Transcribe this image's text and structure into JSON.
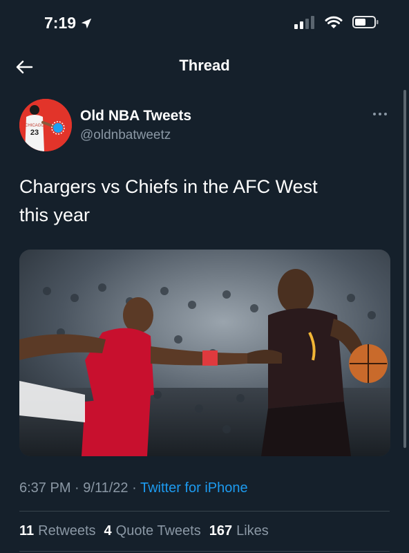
{
  "status_bar": {
    "time": "7:19",
    "icons": [
      "location-arrow-icon",
      "cellular-signal-icon",
      "wifi-icon",
      "battery-icon"
    ]
  },
  "header": {
    "title": "Thread",
    "back_icon": "back-arrow-icon"
  },
  "tweet": {
    "author": {
      "name": "Old NBA Tweets",
      "handle": "@oldnbatweetz",
      "avatar_text": {
        "team": "CHICAGO",
        "number": "23"
      }
    },
    "text": "Chargers vs Chiefs in the AFC West\nthis year",
    "media_icon": "basketball-photo",
    "meta": {
      "time": "6:37 PM",
      "separator": "·",
      "date": "9/11/22",
      "source": "Twitter for iPhone"
    },
    "stats": {
      "retweets": {
        "count": "11",
        "label": "Retweets"
      },
      "quotes": {
        "count": "4",
        "label": "Quote Tweets"
      },
      "likes": {
        "count": "167",
        "label": "Likes"
      }
    }
  },
  "colors": {
    "background": "#15202b",
    "secondary_text": "#8b98a5",
    "link": "#1d9bf0",
    "avatar_bg": "#e2342a",
    "divider": "#38444d"
  }
}
